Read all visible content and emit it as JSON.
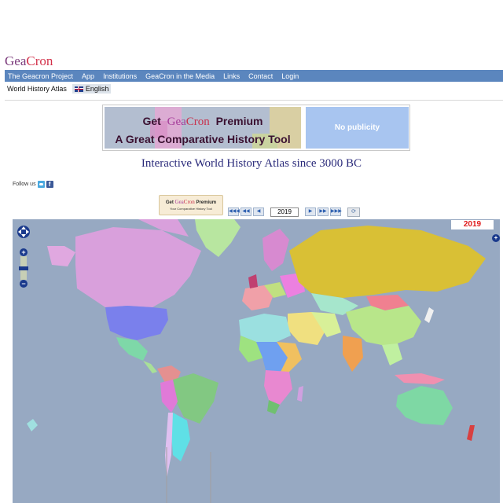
{
  "logo": {
    "part1": "Gea",
    "part2": "Cron"
  },
  "topnav": {
    "items": [
      "The Geacron Project",
      "App",
      "Institutions",
      "GeaCron in the Media",
      "Links",
      "Contact",
      "Login"
    ]
  },
  "subnav": {
    "atlas": "World History Atlas",
    "language": "English"
  },
  "banner": {
    "line1_get": "Get",
    "line1_gea": "Gea",
    "line1_cron": "Cron",
    "line1_premium": "Premium",
    "line2": "A Great Comparative History Tool",
    "right": "No publicity"
  },
  "headline": "Interactive World History Atlas since 3000 BC",
  "follow": {
    "label": "Follow us"
  },
  "premium_button": {
    "get": "Get",
    "gea": "Gea",
    "cron": "Cron",
    "premium": "Premium",
    "subtitle": "Your Comparative History Tool"
  },
  "timeline": {
    "first": "◀◀◀",
    "back_fast": "◀◀",
    "back": "◀",
    "year": "2019",
    "forward": "▶",
    "forward_fast": "▶▶",
    "last": "▶▶▶",
    "refresh": "⟳"
  },
  "map": {
    "year_label": "2019",
    "ocean_color": "#97a9c2",
    "zoom_in": "+",
    "zoom_out": "−",
    "layer_switch": "+"
  }
}
